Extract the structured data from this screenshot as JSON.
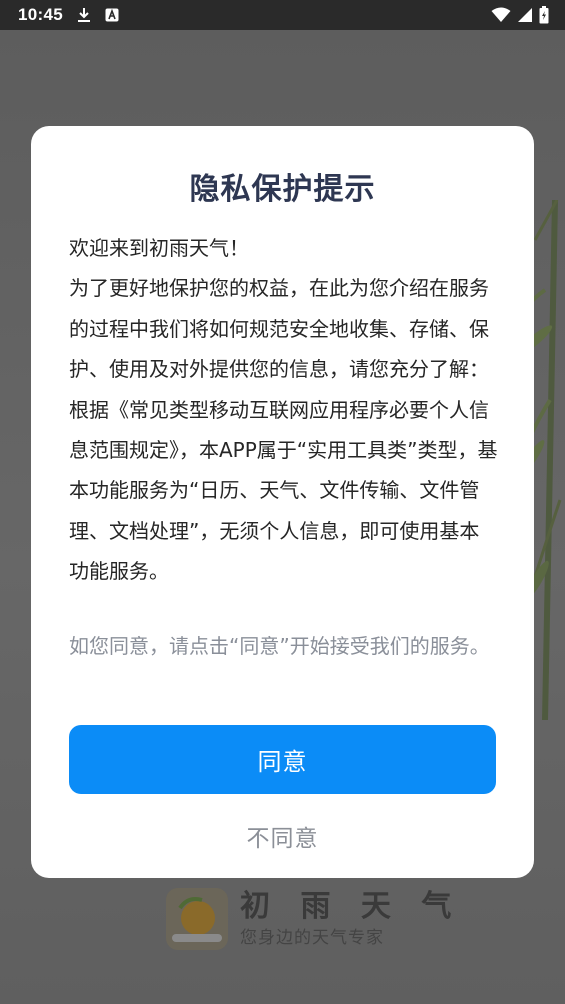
{
  "status_bar": {
    "time": "10:45",
    "icons": [
      "download-icon",
      "app-notification-icon",
      "wifi-icon",
      "cellular-signal-icon",
      "battery-charging-icon"
    ]
  },
  "splash": {
    "app_name": "初 雨 天 气",
    "slogan": "您身边的天气专家"
  },
  "dialog": {
    "title": "隐私保护提示",
    "paragraphs": [
      "欢迎来到初雨天气！",
      "为了更好地保护您的权益，在此为您介绍在服务的过程中我们将如何规范安全地收集、存储、保护、使用及对外提供您的信息，请您充分了解：",
      "根据《常见类型移动互联网应用程序必要个人信息范围规定》，本APP属于“实用工具类”类型，基本功能服务为“日历、天气、文件传输、文件管理、文档处理”，无须个人信息，即可使用基本功能服务。"
    ],
    "hint": "如您同意，请点击“同意”开始接受我们的服务。",
    "agree_label": "同意",
    "disagree_label": "不同意"
  },
  "colors": {
    "accent": "#0b8cf7",
    "title": "#2e3752",
    "hint": "#8a8f99"
  }
}
